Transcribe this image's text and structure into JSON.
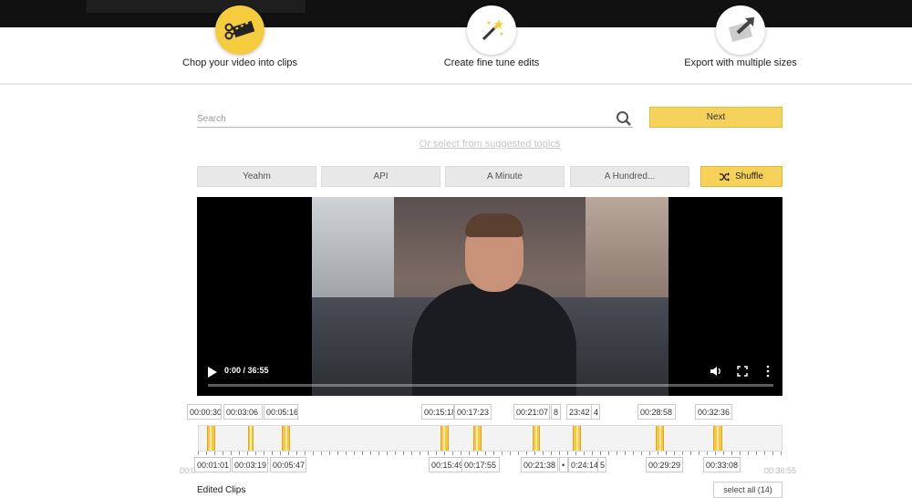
{
  "features": [
    {
      "label": "Chop your video into clips",
      "icon": "scissors-film-icon"
    },
    {
      "label": "Create fine tune edits",
      "icon": "magic-wand-icon"
    },
    {
      "label": "Export with multiple sizes",
      "icon": "export-arrow-icon"
    }
  ],
  "search": {
    "placeholder": "Search",
    "next_label": "Next"
  },
  "suggest_link": "Or select from suggested topics",
  "topics": [
    "Yeahm",
    "API",
    "A Minute",
    "A Hundred..."
  ],
  "shuffle_label": "Shuffle",
  "video": {
    "time": "0:00 / 36:55",
    "progress": 0
  },
  "top_timestamps": [
    "00:00:30",
    "00:03:06",
    "00:05:16",
    "00:15:18",
    "00:17:23",
    "00:21:07",
    "8",
    "23:42",
    "4",
    "00:28:58",
    "00:32:36"
  ],
  "bottom_timestamps": [
    "00:01:01",
    "00:03:19",
    "00:05:47",
    "00:15:49",
    "00:17:55",
    "00:21:38",
    "•",
    "0:24:14",
    "5",
    "00:29:29",
    "00:33:08"
  ],
  "clips": [
    {
      "start": "00:00:30",
      "end": "00:01:01"
    },
    {
      "start": "00:03:06",
      "end": "00:03:19"
    },
    {
      "start": "00:05:16",
      "end": "00:05:47"
    },
    {
      "start": "00:15:18",
      "end": "00:15:49"
    },
    {
      "start": "00:17:23",
      "end": "00:17:55"
    },
    {
      "start": "00:21:07",
      "end": "00:21:38"
    },
    {
      "start": "00:23:42",
      "end": "00:24:14"
    },
    {
      "start": "00:28:58",
      "end": "00:29:29"
    },
    {
      "start": "00:32:36",
      "end": "00:33:08"
    }
  ],
  "range": {
    "start": "00:0",
    "end": "00:36:55"
  },
  "edited_clips": {
    "title": "Edited Clips",
    "select_all": "select all (14)"
  },
  "colors": {
    "accent": "#f7d25a",
    "clip": "#f5c842"
  }
}
